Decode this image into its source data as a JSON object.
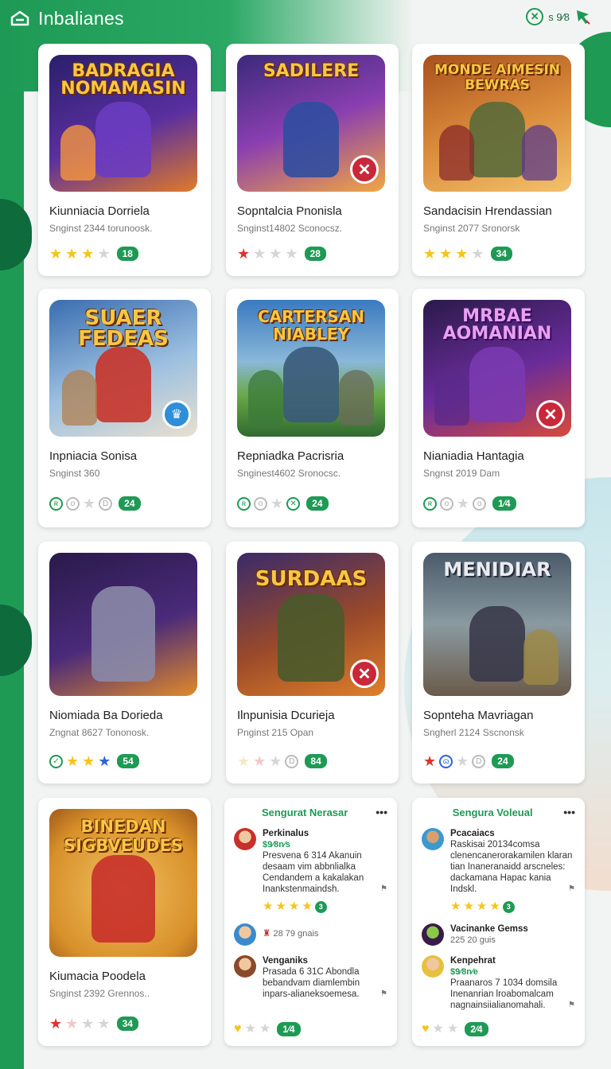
{
  "header": {
    "title": "Inbalianes",
    "status": "s 9⁄8"
  },
  "colors": {
    "brand_green": "#1e9a55",
    "star_gold": "#f5c518",
    "star_red": "#e03030",
    "badge_red": "#c8283a"
  },
  "cards": [
    {
      "thumb_title": "BADRAGIA NOMAMASIN",
      "name": "Kiunniacia Dorriela",
      "sub": "Snginst 2344 torunoosk.",
      "badge": "18",
      "theme": [
        "#2a1f6b",
        "#5a2fa0",
        "#e07a28"
      ]
    },
    {
      "thumb_title": "SADILERE",
      "name": "Sopntalcia Pnonisla",
      "sub": "Snginst14802 Sconocsz.",
      "badge": "28",
      "theme": [
        "#3a2a7a",
        "#8a3fb0",
        "#f2a640"
      ]
    },
    {
      "thumb_title": "MONDE AIMESIN BEWRAS",
      "name": "Sandacisin Hrendassian",
      "sub": "Snginst 2077 Sronorsk",
      "badge": "34",
      "theme": [
        "#a8501e",
        "#d98a3a",
        "#f4c16a"
      ]
    },
    {
      "thumb_title": "SUAER FEDEAS",
      "name": "Inpniacia Sonisa",
      "sub": "Snginst 360",
      "badge": "24",
      "theme": [
        "#3a6db0",
        "#9cc0e0",
        "#c8342a"
      ]
    },
    {
      "thumb_title": "CARTERSAN NIABLEY",
      "name": "Repniadka Pacrisria",
      "sub": "Snginest4602 Sronocsc.",
      "badge": "24",
      "theme": [
        "#3a7ac0",
        "#6aa848",
        "#2f6a30"
      ]
    },
    {
      "thumb_title": "MRBAE AOMANIAN",
      "name": "Nianiadia Hantagia",
      "sub": "Sngnst 2019 Dam",
      "badge": "1⁄4",
      "theme": [
        "#2a1a4a",
        "#6a2c9a",
        "#d84a3a"
      ]
    },
    {
      "thumb_title": "",
      "name": "Niomiada Ba Dorieda",
      "sub": "Zngnat 8627 Tononosk.",
      "badge": "54",
      "theme": [
        "#2a1a4a",
        "#4a2a7a",
        "#e08a2a"
      ]
    },
    {
      "thumb_title": "SURDAAS",
      "name": "Ilnpunisia Dcurieja",
      "sub": "Pnginst 215 Opan",
      "badge": "84",
      "theme": [
        "#3a2a6a",
        "#9a4a2a",
        "#e0802a"
      ]
    },
    {
      "thumb_title": "MENIDIAR",
      "name": "Sopnteha Mavriagan",
      "sub": "Sngherl 2124 Sscnonsk",
      "badge": "24",
      "theme": [
        "#4a5a6a",
        "#8a9aa0",
        "#d8a040"
      ]
    },
    {
      "thumb_title": "BINEDAN SIGBVEUDES",
      "name": "Kiumacia Poodela",
      "sub": "Snginst 2392 Grennos..",
      "badge": "34",
      "theme": [
        "#d8902a",
        "#f0c060",
        "#c8302a"
      ]
    }
  ],
  "reviews": [
    {
      "title": "Sengurat Nerasar",
      "items": [
        {
          "name": "Perkinalus",
          "meta": "$9⁄8n⁄s",
          "text": "Presvena 6 314 Akanuin desaam vim abbnlialka Cendandem a kakalakan Inankstenmaindsh.",
          "rating": "3"
        },
        {
          "name": "",
          "meta": "28 79 gnais",
          "text": "",
          "rating": ""
        },
        {
          "name": "Venganiks",
          "meta": "",
          "text": "Prasada 6 31C Abondla bebandvam diamlembin inpars-alianeksoemesa.",
          "rating": ""
        }
      ],
      "footer_badge": "1⁄4"
    },
    {
      "title": "Sengura Voleual",
      "items": [
        {
          "name": "Pcacaiacs",
          "meta": "",
          "text": "Raskisai 20134comsa clenencanerorakamilen klaran tian Inaneranaidd arscneles: dackamana Hapac kania Indskl.",
          "rating": "3"
        },
        {
          "name": "Vacinanke Gemss",
          "meta": "225 20 guis",
          "text": "",
          "rating": ""
        },
        {
          "name": "Kenpehrat",
          "meta": "$9⁄8n⁄e",
          "text": "Praanaros 7 1034 domsila Inenanrian lroabomalcam nagnainsiialianomahali.",
          "rating": ""
        }
      ],
      "footer_badge": "2⁄4"
    }
  ]
}
